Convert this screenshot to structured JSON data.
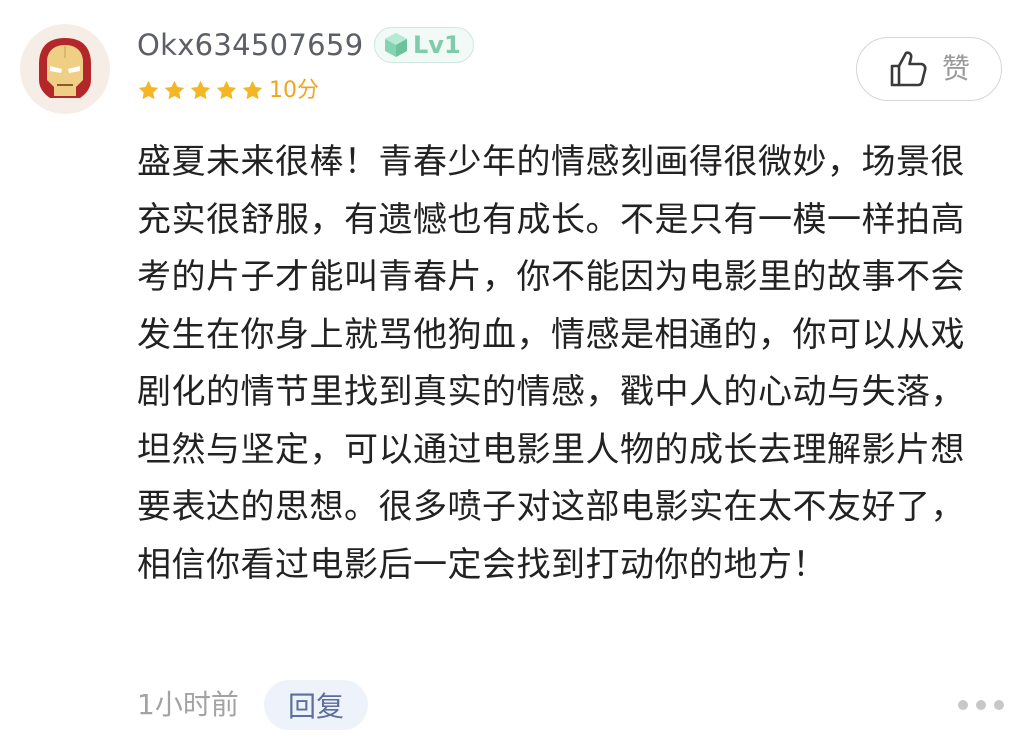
{
  "comment": {
    "user": {
      "avatar_icon": "iron-man-helmet-icon",
      "username": "Okx634507659",
      "level_icon": "hexagon-gem-icon",
      "level_label": "Lv1"
    },
    "rating": {
      "stars": 5,
      "max_stars": 5,
      "score_label": "10分",
      "star_color": "#f5b626"
    },
    "like_button": {
      "icon": "thumbs-up-icon",
      "label": "赞"
    },
    "body": "盛夏未来很棒！青春少年的情感刻画得很微妙，场景很充实很舒服，有遗憾也有成长。不是只有一模一样拍高考的片子才能叫青春片，你不能因为电影里的故事不会发生在你身上就骂他狗血，情感是相通的，你可以从戏剧化的情节里找到真实的情感，戳中人的心动与失落，坦然与坚定，可以通过电影里人物的成长去理解影片想要表达的思想。很多喷子对这部电影实在太不友好了，相信你看过电影后一定会找到打动你的地方！",
    "footer": {
      "time": "1小时前",
      "reply_label": "回复",
      "more_icon": "more-dots-icon"
    }
  },
  "colors": {
    "accent_level": "#7fcbab",
    "score": "#f2a51a",
    "reply_bg": "#eef2fa",
    "reply_text": "#5a6f9f"
  }
}
